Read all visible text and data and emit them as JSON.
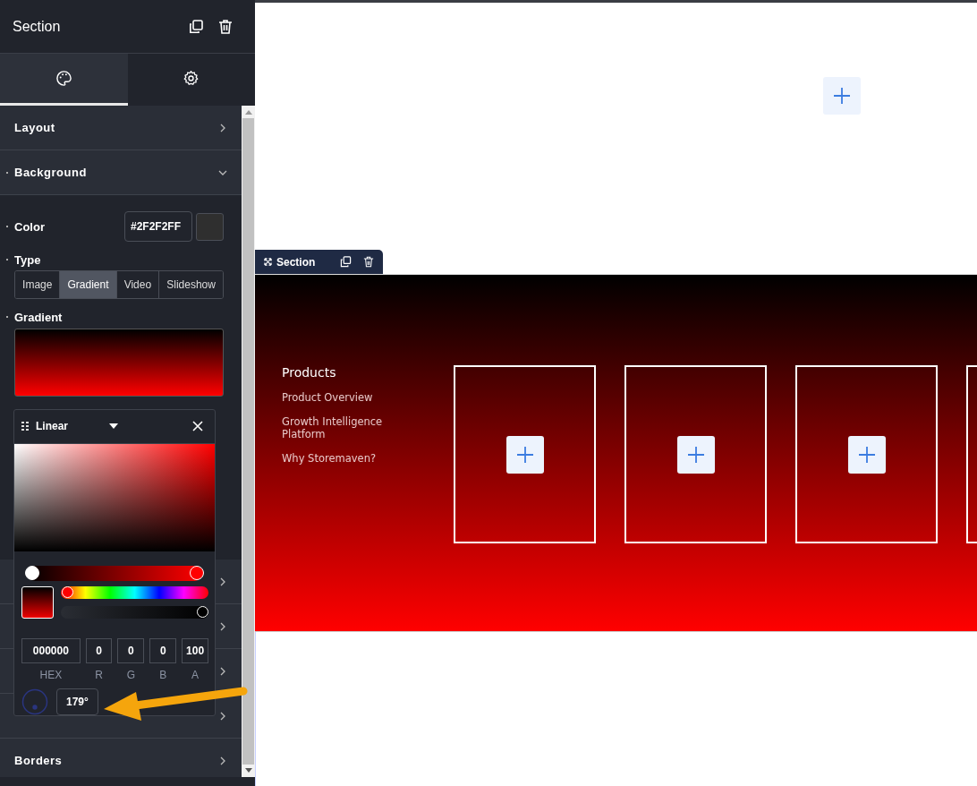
{
  "panel": {
    "title": "Section",
    "tabs": [
      {
        "selected": true
      },
      {
        "selected": false
      }
    ],
    "sections": [
      {
        "label": "Layout",
        "expanded": false
      },
      {
        "label": "Background",
        "expanded": true
      }
    ],
    "background": {
      "color_label": "Color",
      "color_value": "#2F2F2FF",
      "type_label": "Type",
      "types": [
        {
          "label": "Image",
          "selected": false
        },
        {
          "label": "Gradient",
          "selected": true
        },
        {
          "label": "Video",
          "selected": false
        },
        {
          "label": "Slideshow",
          "selected": false
        }
      ],
      "gradient_label": "Gradient"
    },
    "lower_sections": [
      {
        "label": "Borders"
      }
    ]
  },
  "picker": {
    "mode": "Linear",
    "stops": [
      {
        "level": 0
      },
      {
        "level": 1
      }
    ],
    "hue": {
      "level": 0
    },
    "alpha": {
      "level": 1
    },
    "fields": [
      {
        "value": "000000",
        "label": "HEX"
      },
      {
        "value": "0",
        "label": "R"
      },
      {
        "value": "0",
        "label": "G"
      },
      {
        "value": "0",
        "label": "B"
      },
      {
        "value": "100",
        "label": "A"
      }
    ],
    "angle": "179°"
  },
  "canvas": {
    "section_tab": "Section",
    "menu": {
      "heading": "Products",
      "links": [
        "Product Overview",
        "Growth Intelligence Platform",
        "Why Storemaven?"
      ]
    }
  }
}
